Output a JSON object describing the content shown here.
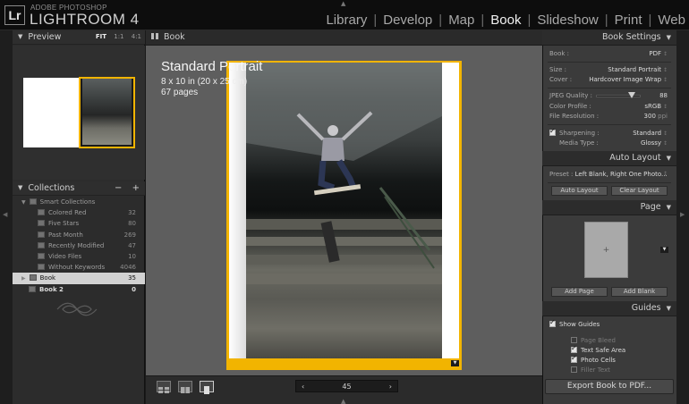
{
  "app": {
    "logo": "Lr",
    "brand_small": "ADOBE PHOTOSHOP",
    "brand_name": "LIGHTROOM 4"
  },
  "modules": [
    {
      "label": "Library",
      "active": false
    },
    {
      "label": "Develop",
      "active": false
    },
    {
      "label": "Map",
      "active": false
    },
    {
      "label": "Book",
      "active": true
    },
    {
      "label": "Slideshow",
      "active": false
    },
    {
      "label": "Print",
      "active": false
    },
    {
      "label": "Web",
      "active": false
    }
  ],
  "preview": {
    "title": "Preview",
    "zoom": [
      "FIT",
      "1:1",
      "4:1"
    ]
  },
  "collections": {
    "title": "Collections",
    "add_icons": [
      "−",
      "+"
    ],
    "items": [
      {
        "label": "Smart Collections",
        "count": "",
        "indent": 1,
        "type": "group"
      },
      {
        "label": "Colored Red",
        "count": "32",
        "indent": 2
      },
      {
        "label": "Five Stars",
        "count": "80",
        "indent": 2
      },
      {
        "label": "Past Month",
        "count": "269",
        "indent": 2
      },
      {
        "label": "Recently Modified",
        "count": "47",
        "indent": 2
      },
      {
        "label": "Video Files",
        "count": "10",
        "indent": 2
      },
      {
        "label": "Without Keywords",
        "count": "4046",
        "indent": 2
      },
      {
        "label": "Book",
        "count": "35",
        "indent": 1,
        "selected": true
      },
      {
        "label": "Book 2",
        "count": "0",
        "indent": 1,
        "bold": true
      }
    ]
  },
  "center": {
    "tab_title": "Book",
    "overlay_title": "Standard Portrait",
    "overlay_size": "8 x 10 in (20 x 25 cm)",
    "overlay_pages": "67 pages",
    "page_number": "45",
    "prev_arrow": "‹",
    "next_arrow": "›"
  },
  "book_settings": {
    "title": "Book Settings",
    "book_label": "Book :",
    "book_value": "PDF",
    "size_label": "Size :",
    "size_value": "Standard Portrait",
    "cover_label": "Cover :",
    "cover_value": "Hardcover Image Wrap",
    "jpeg_label": "JPEG Quality :",
    "jpeg_value": "88",
    "jpeg_quality": 88,
    "profile_label": "Color Profile :",
    "profile_value": "sRGB",
    "resolution_label": "File Resolution :",
    "resolution_value": "300",
    "resolution_unit": "ppi",
    "sharpening_label": "Sharpening :",
    "sharpening_value": "Standard",
    "media_label": "Media Type :",
    "media_value": "Glossy"
  },
  "auto_layout": {
    "title": "Auto Layout",
    "preset_label": "Preset :",
    "preset_value": "Left Blank, Right One Photo...",
    "auto_button": "Auto Layout",
    "clear_button": "Clear Layout"
  },
  "page_panel": {
    "title": "Page",
    "add_page": "Add Page",
    "add_blank": "Add Blank",
    "thumb_mark": "+"
  },
  "guides": {
    "title": "Guides",
    "show_guides": "Show Guides",
    "items": [
      {
        "label": "Page Bleed",
        "checked": false
      },
      {
        "label": "Text Safe Area",
        "checked": true
      },
      {
        "label": "Photo Cells",
        "checked": true
      },
      {
        "label": "Filler Text",
        "checked": false
      }
    ]
  },
  "export_button": "Export Book to PDF...",
  "colors": {
    "accent": "#f2b400",
    "bg": "#5e5e5e"
  }
}
